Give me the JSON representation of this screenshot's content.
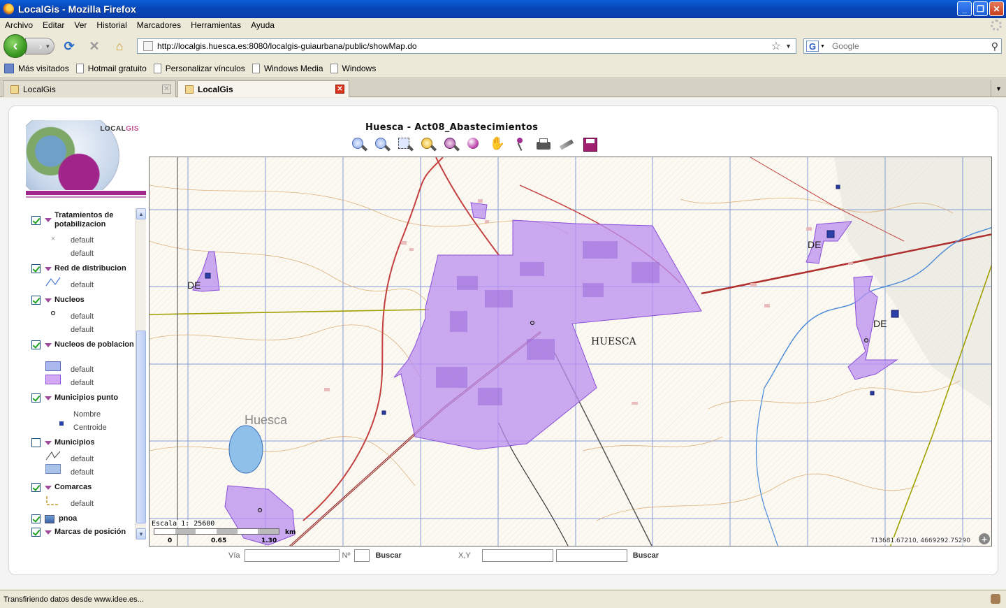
{
  "window": {
    "title": "LocalGis - Mozilla Firefox"
  },
  "menu": [
    "Archivo",
    "Editar",
    "Ver",
    "Historial",
    "Marcadores",
    "Herramientas",
    "Ayuda"
  ],
  "nav": {
    "url": "http://localgis.huesca.es:8080/localgis-guiaurbana/public/showMap.do",
    "search_placeholder": "Google"
  },
  "bookmarks": [
    "Más visitados",
    "Hotmail gratuito",
    "Personalizar vínculos",
    "Windows Media",
    "Windows"
  ],
  "tabs": [
    {
      "label": "LocalGis",
      "active": false
    },
    {
      "label": "LocalGis",
      "active": true
    }
  ],
  "logo": {
    "text_a": "LOCAL",
    "text_b": "GIS"
  },
  "map": {
    "title": "Huesca - Act08_Abastecimientos",
    "scale_label": "Escala 1: 25600",
    "scale_ticks": [
      "0",
      "0.65",
      "1.30",
      "km"
    ],
    "coords": "713681.67210, 4669292.75290",
    "labels": [
      "HUESCA",
      "Huesca",
      "DE",
      "DE",
      "DE"
    ]
  },
  "toolbar_icons": [
    "zoom-in-icon",
    "zoom-out-icon",
    "zoom-box-icon",
    "zoom-extent-icon",
    "zoom-previous-icon",
    "globe-icon",
    "pan-hand-icon",
    "place-pin-icon",
    "print-icon",
    "measure-icon",
    "save-icon"
  ],
  "legend": {
    "layers": [
      {
        "title": "Tratamientos de potabilizacion",
        "checked": true,
        "items": [
          "default",
          "default"
        ]
      },
      {
        "title": "Red de distribucion",
        "checked": true,
        "items": [
          "default"
        ]
      },
      {
        "title": "Nucleos",
        "checked": true,
        "items": [
          "default",
          "default"
        ]
      },
      {
        "title": "Nucleos de poblacion",
        "checked": true,
        "items": [
          "default",
          "default"
        ]
      },
      {
        "title": "Municipios punto",
        "checked": true,
        "items": [
          "Nombre",
          "Centroide"
        ]
      },
      {
        "title": "Municipios",
        "checked": false,
        "items": [
          "default",
          "default"
        ]
      },
      {
        "title": "Comarcas",
        "checked": true,
        "items": [
          "default"
        ]
      },
      {
        "title": "pnoa",
        "checked": true,
        "items": []
      },
      {
        "title": "Marcas de posición",
        "checked": true,
        "items": []
      }
    ]
  },
  "search": {
    "via_label": "Vía",
    "num_label": "Nº",
    "buscar1": "Buscar",
    "xy_label": "X,Y",
    "buscar2": "Buscar"
  },
  "status": "Transfiriendo datos desde www.idee.es...",
  "colors": {
    "polygon_fill": "#b98ef0",
    "polygon_stroke": "#8a4ed8",
    "brand": "#a0248a"
  }
}
